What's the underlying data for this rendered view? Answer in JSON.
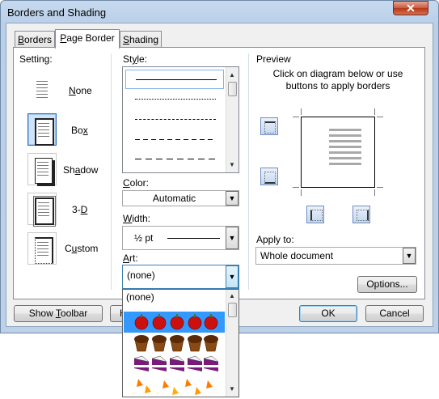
{
  "window": {
    "title": "Borders and Shading",
    "close_glyph": "✕"
  },
  "tabs": [
    {
      "label": "Borders",
      "mnemonic": "B",
      "rest": "orders"
    },
    {
      "label": "Page Border",
      "mnemonic": "P",
      "rest": "age Border"
    },
    {
      "label": "Shading",
      "mnemonic": "S",
      "rest": "hading"
    }
  ],
  "setting": {
    "label": "Setting:",
    "options": [
      {
        "pre": "",
        "mn": "N",
        "post": "one",
        "full": "None"
      },
      {
        "pre": "Bo",
        "mn": "x",
        "post": "",
        "full": "Box"
      },
      {
        "pre": "Sh",
        "mn": "a",
        "post": "dow",
        "full": "Shadow"
      },
      {
        "pre": "3-",
        "mn": "D",
        "post": "",
        "full": "3-D"
      },
      {
        "pre": "C",
        "mn": "u",
        "post": "stom",
        "full": "Custom"
      }
    ]
  },
  "style": {
    "label": "Style:",
    "mn": "y",
    "styles": [
      "solid",
      "dotted",
      "dashed-small",
      "dashed-medium",
      "dashed-long"
    ]
  },
  "color": {
    "label": "Color:",
    "value": "Automatic"
  },
  "width": {
    "label": "Width:",
    "value": "½ pt"
  },
  "art": {
    "label": "Art:",
    "value": "(none)",
    "options": [
      "(none)",
      "apples",
      "cupcakes",
      "cakes",
      "candy corn"
    ]
  },
  "preview": {
    "label": "Preview",
    "instruction": "Click on diagram below or use buttons to apply borders"
  },
  "apply_to": {
    "label": "Apply to:",
    "value": "Whole document"
  },
  "buttons": {
    "options": "Options...",
    "show_toolbar": "Show Toolbar",
    "horizontal_line_partial": "H",
    "ok": "OK",
    "cancel": "Cancel"
  },
  "colors": {
    "accent_select": "#3399ff",
    "title_bar": "#bdd1e8"
  }
}
